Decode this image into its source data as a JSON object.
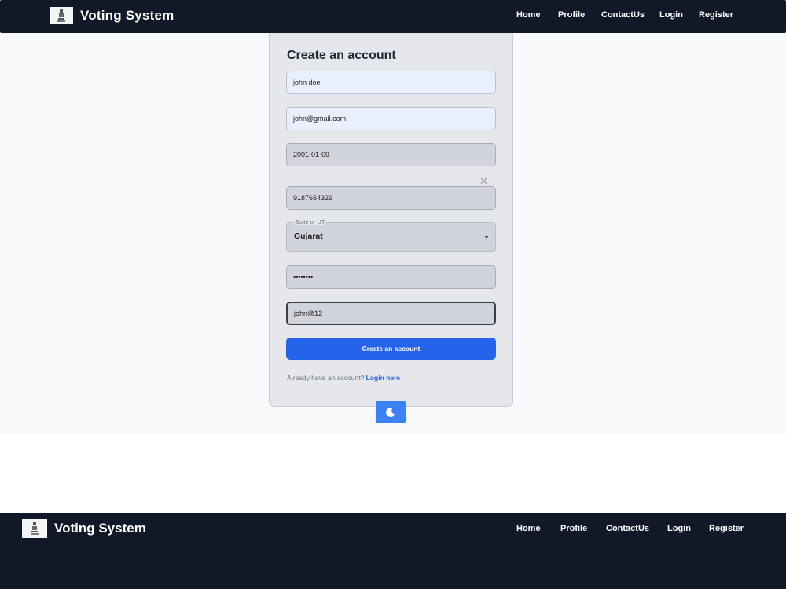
{
  "header": {
    "brand": "Voting System",
    "nav": [
      "Home",
      "Profile",
      "ContactUs",
      "Login",
      "Register"
    ]
  },
  "form": {
    "title": "Create an account",
    "name_value": "john doe",
    "email_value": "john@gmail.com",
    "dob_value": "2001-01-09",
    "clear_symbol": "✕",
    "phone_value": "9187654329",
    "state_label": "State or UT",
    "state_value": "Gujarat",
    "password_value": "••••••••",
    "confirm_value": "john@12",
    "submit_label": "Create an account",
    "login_prompt": "Already have an account?",
    "login_link": "Login here"
  },
  "theme_toggle": {
    "icon": "moon-icon"
  },
  "footer": {
    "brand": "Voting System",
    "nav": [
      "Home",
      "Profile",
      "ContactUs",
      "Login",
      "Register"
    ]
  },
  "colors": {
    "navbar": "#111827",
    "accent": "#2563eb",
    "card": "#e5e7eb"
  }
}
